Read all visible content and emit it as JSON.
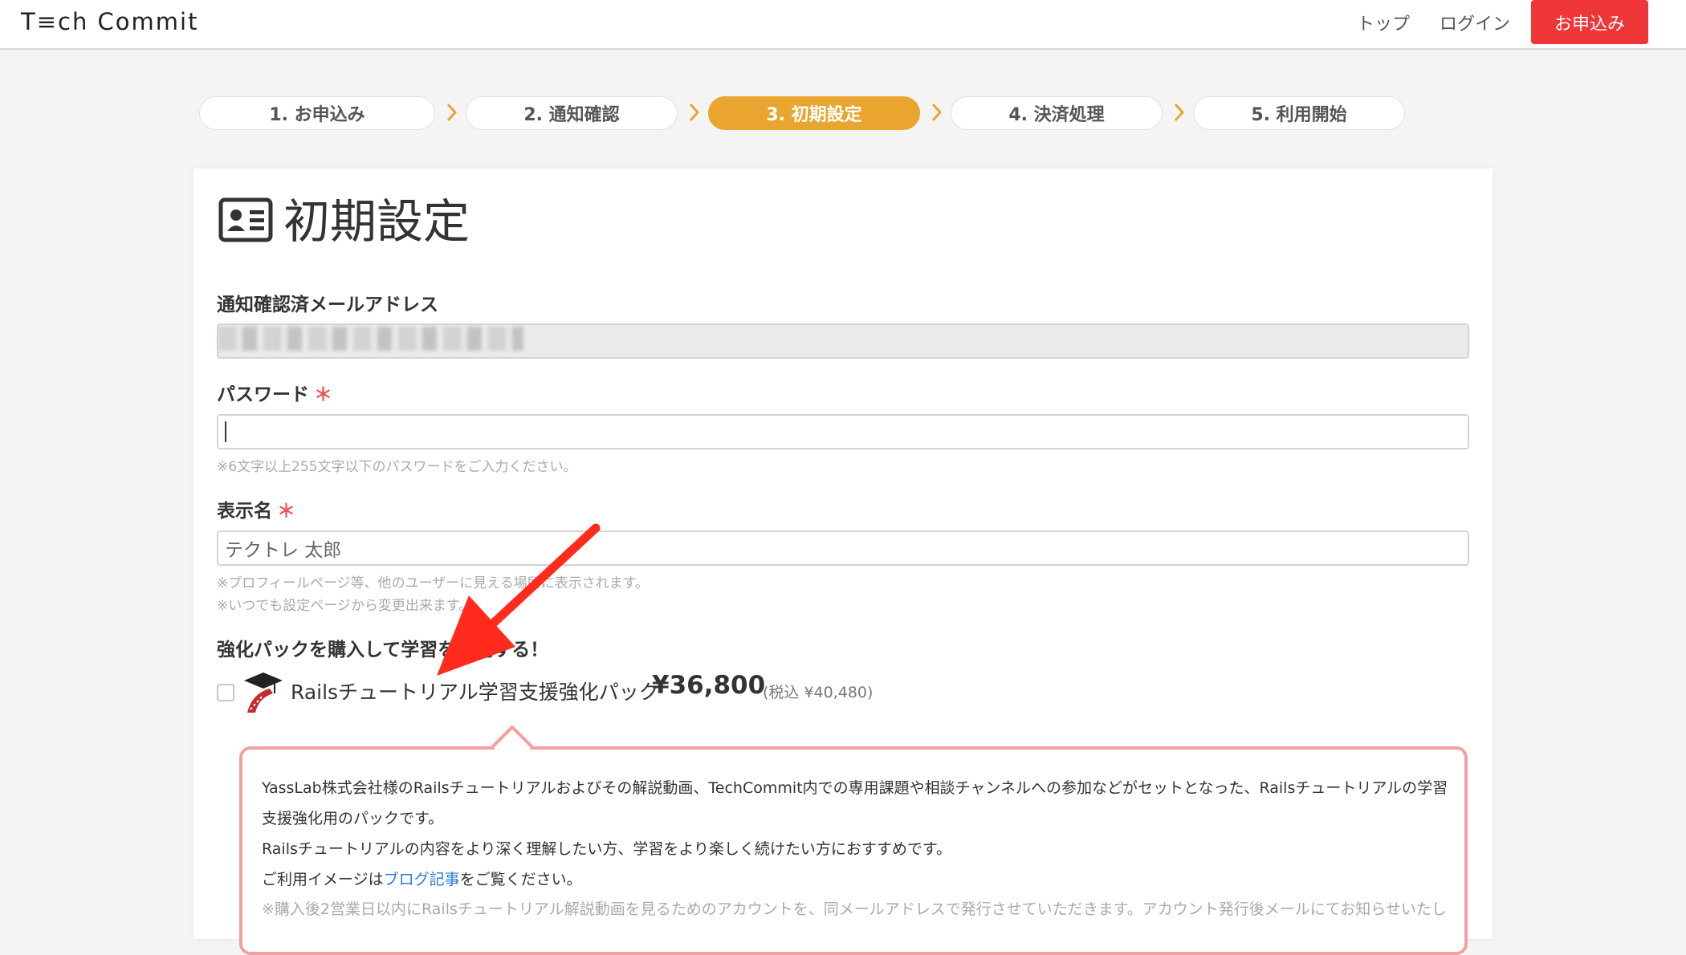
{
  "header": {
    "logo": "T≡ch Commit",
    "nav_top": "トップ",
    "nav_login": "ログイン",
    "apply_button": "お申込み"
  },
  "steps": [
    {
      "label": "1. お申込み",
      "active": false
    },
    {
      "label": "2. 通知確認",
      "active": false
    },
    {
      "label": "3. 初期設定",
      "active": true
    },
    {
      "label": "4. 決済処理",
      "active": false
    },
    {
      "label": "5. 利用開始",
      "active": false
    }
  ],
  "page": {
    "title": "初期設定",
    "email_label": "通知確認済メールアドレス",
    "password_label": "パスワード",
    "required_mark": "＊",
    "password_value": "",
    "password_hint": "※6文字以上255文字以下のパスワードをご入力ください。",
    "display_name_label": "表示名",
    "display_name_placeholder": "テクトレ 太郎",
    "display_name_hint1": "※プロフィールページ等、他のユーザーに見える場所に表示されます。",
    "display_name_hint2": "※いつでも設定ページから変更出来ます。",
    "pack_heading": "強化パックを購入して学習を強化する！",
    "pack_name": "Railsチュートリアル学習支援強化パック",
    "pack_price": "¥36,800",
    "pack_tax": "(税込 ¥40,480)",
    "info_line1": "YassLab株式会社様のRailsチュートリアルおよびその解説動画、TechCommit内での専用課題や相談チャンネルへの参加などがセットとなった、Railsチュートリアルの学習",
    "info_line2": "支援強化用のパックです。",
    "info_line3": "Railsチュートリアルの内容をより深く理解したい方、学習をより楽しく続けたい方におすすめです。",
    "info_line4_pre": "ご利用イメージは",
    "info_line4_link": "ブログ記事",
    "info_line4_post": "をご覧ください。",
    "info_note": "※購入後2営業日以内にRailsチュートリアル解説動画を見るためのアカウントを、同メールアドレスで発行させていただきます。アカウント発行後メールにてお知らせいたし"
  },
  "colors": {
    "accent_active_step": "#e9a52f",
    "apply_button": "#ee3538",
    "required": "#ee5555",
    "annotation_arrow": "#ff2b1c"
  }
}
